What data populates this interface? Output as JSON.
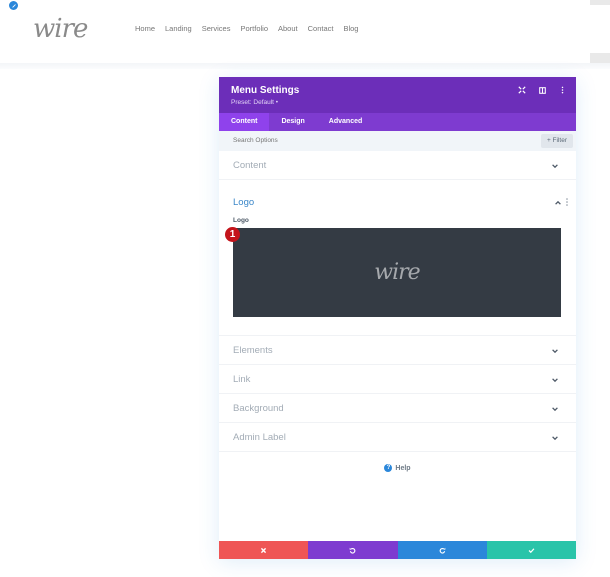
{
  "site": {
    "logo_text": "wire",
    "nav": [
      "Home",
      "Landing",
      "Services",
      "Portfolio",
      "About",
      "Contact",
      "Blog"
    ]
  },
  "modal": {
    "title": "Menu Settings",
    "preset": "Preset: Default •",
    "header_icons": [
      "fullscreen-icon",
      "split-view-icon",
      "more-icon"
    ],
    "tabs": [
      {
        "label": "Content",
        "active": true
      },
      {
        "label": "Design",
        "active": false
      },
      {
        "label": "Advanced",
        "active": false
      }
    ],
    "search": {
      "placeholder": "Search Options",
      "filter_label": "+ Filter"
    },
    "sections": {
      "content": "Content",
      "logo": "Logo",
      "logo_field_label": "Logo",
      "logo_preview_text": "wire",
      "badge": "1",
      "elements": "Elements",
      "link": "Link",
      "background": "Background",
      "admin_label": "Admin Label"
    },
    "help_label": "Help",
    "footer_colors": {
      "cancel": "#ef5555",
      "undo": "#7e3bd0",
      "redo": "#2b87da",
      "save": "#29c4a9"
    }
  },
  "colors": {
    "header_purple": "#6c2eb9",
    "tabs_purple": "#7e3bd0",
    "active_tab": "#8f42ec",
    "accent_blue": "#2b87da",
    "badge_red": "#c4141b"
  }
}
